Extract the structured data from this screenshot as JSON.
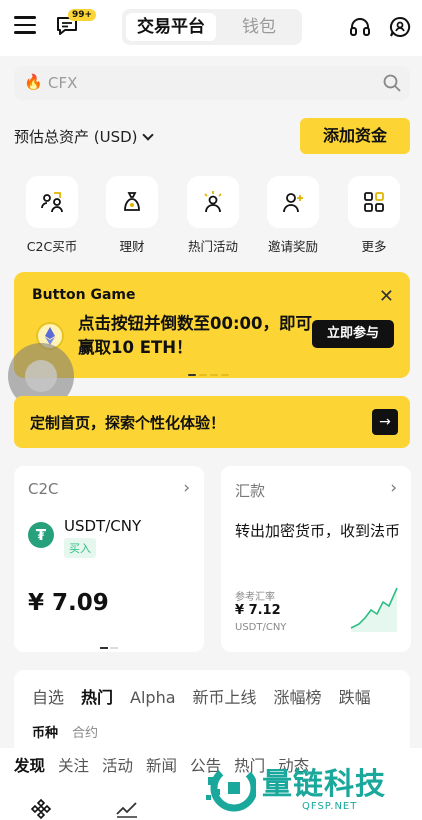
{
  "header": {
    "notification_badge": "99+",
    "tabs": [
      "交易平台",
      "钱包"
    ]
  },
  "search": {
    "placeholder": "CFX"
  },
  "assets": {
    "label": "预估总资产 (USD)",
    "add_funds": "添加资金"
  },
  "quick_actions": [
    {
      "label": "C2C买币",
      "icon": "c2c-people-icon"
    },
    {
      "label": "理财",
      "icon": "money-bag-icon"
    },
    {
      "label": "热门活动",
      "icon": "bulb-person-icon"
    },
    {
      "label": "邀请奖励",
      "icon": "add-user-icon"
    },
    {
      "label": "更多",
      "icon": "grid-icon"
    }
  ],
  "banner": {
    "title": "Button Game",
    "text": "点击按钮并倒数至00:00，即可赢取10 ETH！",
    "cta": "立即参与"
  },
  "customize": {
    "text": "定制首页，探索个性化体验！"
  },
  "c2c_card": {
    "title": "C2C",
    "pair": "USDT/CNY",
    "tag": "买入",
    "price": "¥ 7.09"
  },
  "remit_card": {
    "title": "汇款",
    "desc": "转出加密货币，收到法币",
    "rate_label": "参考汇率",
    "rate_value": "¥ 7.12",
    "rate_pair": "USDT/CNY"
  },
  "market": {
    "tabs": [
      "自选",
      "热门",
      "Alpha",
      "新币上线",
      "涨幅榜",
      "跌幅"
    ],
    "active_tab": 1,
    "sub_tabs": [
      "币种",
      "合约"
    ]
  },
  "feed": {
    "tabs": [
      "发现",
      "关注",
      "活动",
      "新闻",
      "公告",
      "热门",
      "动态"
    ]
  },
  "watermark": {
    "cn": "量链科技",
    "en": "QFSP.NET"
  },
  "colors": {
    "accent": "#fcd535",
    "up": "#2ebd85",
    "watermark": "#1aa89c"
  }
}
